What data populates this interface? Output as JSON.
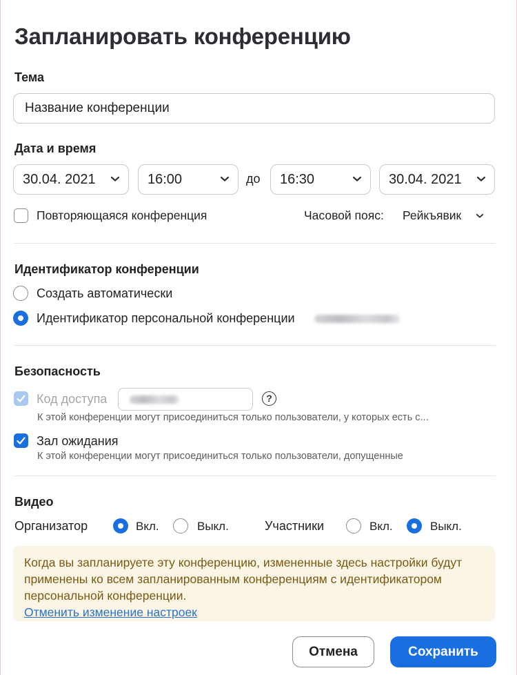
{
  "dialog": {
    "title": "Запланировать конференцию"
  },
  "topic": {
    "label": "Тема",
    "value": "Название конференции"
  },
  "datetime": {
    "label": "Дата и время",
    "start_date": "30.04. 2021",
    "start_time": "16:00",
    "separator": "до",
    "end_time": "16:30",
    "end_date": "30.04. 2021",
    "recurring_label": "Повторяющаяся конференция",
    "recurring_checked": false,
    "timezone_label": "Часовой пояс:",
    "timezone_value": "Рейкъявик"
  },
  "meeting_id": {
    "label": "Идентификатор конференции",
    "options": [
      {
        "label": "Создать автоматически",
        "selected": false
      },
      {
        "label": "Идентификатор персональной конференции",
        "selected": true
      }
    ]
  },
  "security": {
    "label": "Безопасность",
    "passcode_label": "Код доступа",
    "passcode_checked": true,
    "passcode_disabled": true,
    "passcode_hint": "К этой конференции могут присоединиться только пользователи, у которых есть с...",
    "help_symbol": "?",
    "waiting_room_label": "Зал ожидания",
    "waiting_room_checked": true,
    "waiting_room_hint": "К этой конференции могут присоединиться только пользователи, допущенные"
  },
  "video": {
    "label": "Видео",
    "host_label": "Организатор",
    "participants_label": "Участники",
    "on_label": "Вкл.",
    "off_label": "Выкл.",
    "host_on": true,
    "participants_on": false
  },
  "notice": {
    "text": "Когда вы запланируете эту конференцию, измененные здесь настройки будут применены ко всем запланированным конференциям с идентификатором персональной конференции.",
    "link": "Отменить изменение настроек"
  },
  "buttons": {
    "cancel": "Отмена",
    "save": "Сохранить"
  },
  "colors": {
    "accent": "#1a6fe0",
    "notice_bg": "#fbf5e6",
    "notice_text": "#7a5a12",
    "link": "#2a72c9"
  }
}
